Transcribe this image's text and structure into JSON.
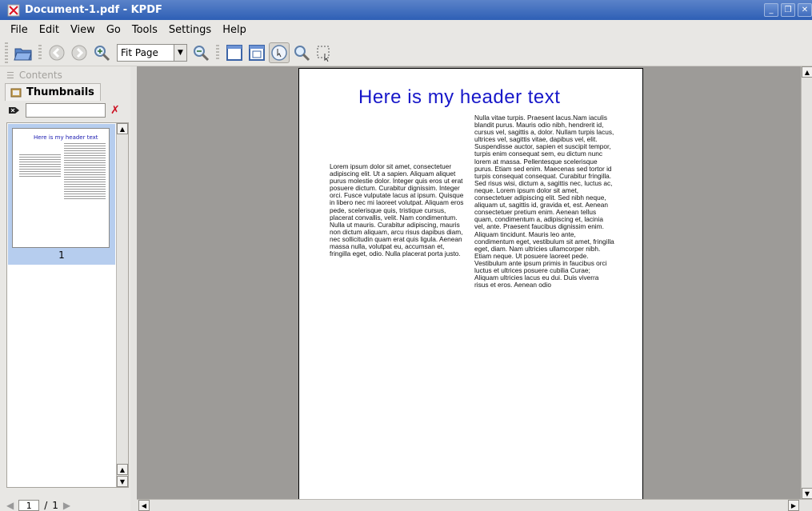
{
  "window": {
    "title": "Document-1.pdf - KPDF"
  },
  "menu": [
    "File",
    "Edit",
    "View",
    "Go",
    "Tools",
    "Settings",
    "Help"
  ],
  "toolbar": {
    "zoom_value": "Fit Page"
  },
  "sidebar": {
    "contents_label": "Contents",
    "thumbnails_label": "Thumbnails",
    "search_value": "",
    "thumbnail_title": "Here is my header text",
    "thumbnail_page_number": "1",
    "current_page": "1",
    "page_separator": "/",
    "total_pages": "1"
  },
  "document": {
    "header": "Here is my header text",
    "left_column": "Lorem ipsum dolor sit amet, consectetuer adipiscing elit. Ut a sapien. Aliquam aliquet purus molestie dolor. Integer quis eros ut erat posuere dictum. Curabitur dignissim. Integer orci. Fusce vulputate lacus at ipsum. Quisque in libero nec mi laoreet volutpat. Aliquam eros pede, scelerisque quis, tristique cursus, placerat convallis, velit. Nam condimentum. Nulla ut mauris. Curabitur adipiscing, mauris non dictum aliquam, arcu risus dapibus diam, nec sollicitudin quam erat quis ligula. Aenean massa nulla, volutpat eu, accumsan et, fringilla eget, odio. Nulla placerat porta justo.",
    "right_column": "Nulla vitae turpis. Praesent lacus.Nam iaculis blandit purus. Mauris odio nibh, hendrerit id, cursus vel, sagittis a, dolor. Nullam turpis lacus, ultrices vel, sagittis vitae, dapibus vel, elit. Suspendisse auctor, sapien et suscipit tempor, turpis enim consequat sem, eu dictum nunc lorem at massa. Pellentesque scelerisque purus. Etiam sed enim. Maecenas sed tortor id turpis consequat consequat. Curabitur fringilla. Sed risus wisi, dictum a, sagittis nec, luctus ac, neque. Lorem ipsum dolor sit amet, consectetuer adipiscing elit. Sed nibh neque, aliquam ut, sagittis id, gravida et, est. Aenean consectetuer pretium enim. Aenean tellus quam, condimentum a, adipiscing et, lacinia vel, ante. Praesent faucibus dignissim enim. Aliquam tincidunt. Mauris leo ante, condimentum eget, vestibulum sit amet, fringilla eget, diam. Nam ultricies ullamcorper nibh. Etiam neque. Ut posuere laoreet pede. Vestibulum ante ipsum primis in faucibus orci luctus et ultrices posuere cubilia Curae; Aliquam ultricies lacus eu dui. Duis viverra risus et eros. Aenean odio"
  },
  "colors": {
    "titlebar": "#2e5fb5",
    "header_text": "#1717c9",
    "thumbnail_selected": "#b6cdee",
    "viewer_background": "#9d9b98"
  },
  "icons": [
    "kpdf-app-icon",
    "open-file-icon",
    "back-icon",
    "forward-icon",
    "zoom-in-icon",
    "zoom-out-icon",
    "fit-width-icon",
    "fit-page-icon",
    "browse-tool-icon",
    "zoom-tool-icon",
    "select-tool-icon",
    "clear-filter-icon"
  ]
}
